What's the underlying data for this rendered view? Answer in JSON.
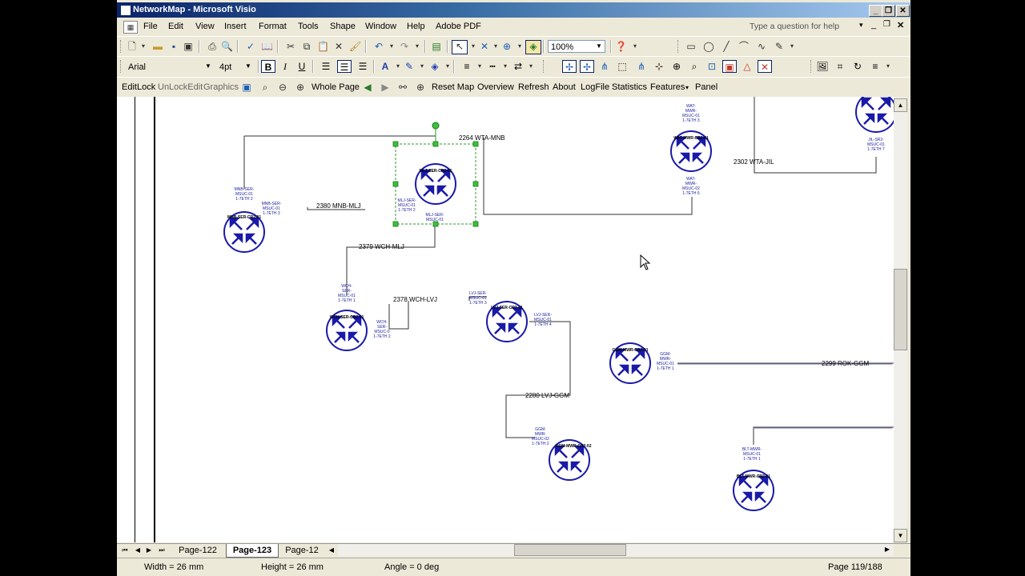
{
  "window": {
    "title": "NetworkMap - Microsoft Visio"
  },
  "menu": {
    "items": [
      "File",
      "Edit",
      "View",
      "Insert",
      "Format",
      "Tools",
      "Shape",
      "Window",
      "Help",
      "Adobe PDF"
    ],
    "help_placeholder": "Type a question for help"
  },
  "toolbar1": {
    "zoom": "100%"
  },
  "toolbar2": {
    "font": "Arial",
    "size": "4pt",
    "bold": "B",
    "italic": "I",
    "underline": "U"
  },
  "toolbar3": {
    "items": [
      "EditLock",
      "UnLockEdit",
      "Graphics",
      "Whole Page",
      "Reset Map",
      "Overview",
      "Refresh",
      "About",
      "LogFile",
      "Statistics",
      "Features",
      "Panel"
    ]
  },
  "tabs": {
    "items": [
      "Page-122",
      "Page-123",
      "Page-12"
    ]
  },
  "status": {
    "width": "Width = 26 mm",
    "height": "Height = 26 mm",
    "angle": "Angle = 0 deg",
    "page": "Page 119/188"
  },
  "diagram": {
    "links": [
      "2264 WTA-MNB",
      "2380 MNB-MLJ",
      "2379 WCH-MLJ",
      "2378 WCH-LVJ",
      "2280 LVJ-GGM",
      "2299 ROK-GGM",
      "2302 WTA-JIL"
    ],
    "nodes": [
      "MNB-SER-CR2-01",
      "MLJ-SER-CR2-01",
      "WCH-SER-CR2-01",
      "LVJ-SER-CR2-01",
      "GGM-MWR-CR2-01",
      "GGM-MWR-CR2-02",
      "WAT-MWR-CR2-01",
      "BLT-MWR-CR2-01"
    ],
    "ports": {
      "mnb_top": [
        "MNB-SER-",
        "MSUC-01",
        "1-7ETH 2"
      ],
      "mnb_right": [
        "MNB-SER-",
        "MSUC-01",
        "1-7ETH 3"
      ],
      "mlj_left": [
        "MLJ-SER-",
        "MSUC-01",
        "1-7ETH 2"
      ],
      "mlj_bottom": [
        "MLJ-SER-",
        "MSUC-01"
      ],
      "wch_top": [
        "WCH-",
        "SER-",
        "MSUC-01",
        "1-7ETH 1"
      ],
      "wch_right": [
        "WCH-",
        "SER-",
        "MSUC-0",
        "1-7ETH 2"
      ],
      "lvj_top": [
        "LVJ-SER-",
        "MSUC-01",
        "1-7ETH 3"
      ],
      "lvj_right": [
        "LVJ-SER-",
        "MSUC-01",
        "1-7ETH 4"
      ],
      "ggm1_right": [
        "GGM-",
        "MWR-",
        "MSUC-01",
        "1-7ETH 1"
      ],
      "ggm2_top": [
        "GGM-",
        "MWR-",
        "MSUC-02",
        "1-7ETH 2"
      ],
      "wat_top": [
        "WAT-",
        "MWR-",
        "MSUC-01",
        "1-7ETH 3"
      ],
      "wat_bottom": [
        "WAT-",
        "MWR-",
        "MSUC-02",
        "1-7ETH 6"
      ],
      "jil_right": [
        "JIL-SR2-",
        "MSUC-01",
        "1-7ETH 7"
      ],
      "blt_top": [
        "BLT-MWR-",
        "MSUC-01",
        "1-7ETH 1"
      ]
    }
  }
}
